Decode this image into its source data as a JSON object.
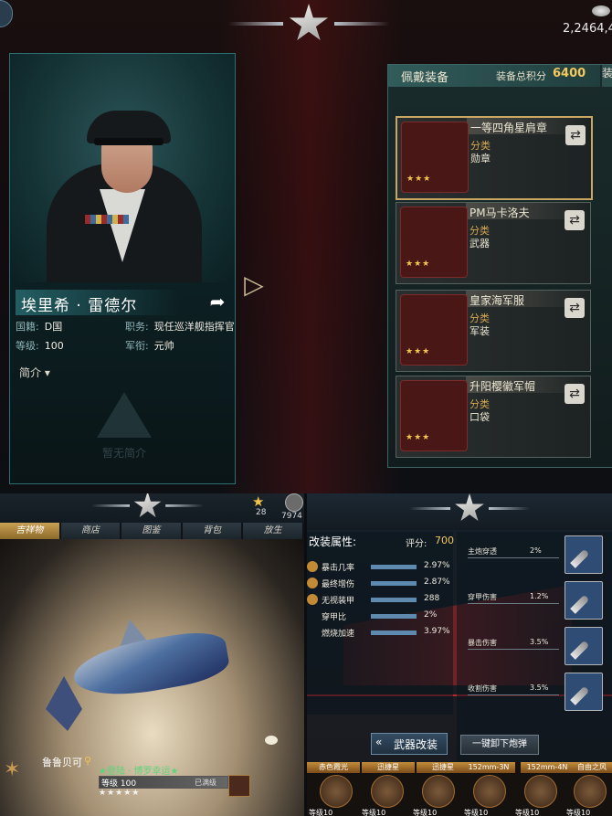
{
  "top": {
    "currency": {
      "amount": "2,2464,4"
    },
    "commander": {
      "name": "埃里希 · 雷德尔",
      "fields": [
        {
          "key": "国籍:",
          "value": "D国",
          "extra": "职务:",
          "extra_value": "现任巡洋舰指挥官"
        },
        {
          "key": "等级:",
          "value": "100",
          "extra": "军衔:",
          "extra_value": "元帅"
        }
      ],
      "intro_label": "简介",
      "no_intro": "暂无简介"
    },
    "equipment": {
      "title": "佩戴装备",
      "score_label": "装备总积分",
      "score": "6400",
      "side_tab": "装",
      "category_label": "分类",
      "items": [
        {
          "name": "一等四角星肩章",
          "category": "勋章",
          "stars": "★★★",
          "selected": true
        },
        {
          "name": "PM马卡洛夫",
          "category": "武器",
          "stars": "★★★",
          "selected": false
        },
        {
          "name": "皇家海军服",
          "category": "军装",
          "stars": "★★★",
          "selected": false
        },
        {
          "name": "升阳樱徽军帽",
          "category": "口袋",
          "stars": "★★★",
          "selected": false
        }
      ]
    }
  },
  "bottom_left": {
    "star_count": "28",
    "resource_count": "7974",
    "tabs": [
      "吉祥物",
      "商店",
      "图鉴",
      "背包",
      "放生"
    ],
    "active_tab": 0,
    "pet": {
      "name": "鲁鲁贝可",
      "title": "★登陆 · 博罗幸运★",
      "level": "等级 100",
      "max": "已满级",
      "stars": "★★★★★"
    }
  },
  "bottom_right": {
    "title": "改装属性:",
    "score_label": "评分:",
    "score": "700",
    "mod_stats": [
      {
        "label": "暴击几率",
        "value": "2.97%"
      },
      {
        "label": "最终增伤",
        "value": "2.87%"
      },
      {
        "label": "无视装甲",
        "value": "288"
      },
      {
        "label": "穿甲比",
        "value": "2%"
      },
      {
        "label": "燃烧加速",
        "value": "3.97%"
      }
    ],
    "side_stats": [
      {
        "label": "主炮穿透",
        "value": "2%"
      },
      {
        "label": "穿甲伤害",
        "value": "1.2%"
      },
      {
        "label": "暴击伤害",
        "value": "3.5%"
      },
      {
        "label": "收割伤害",
        "value": "3.5%"
      }
    ],
    "mod_button": "武器改装",
    "unload_button": "一键卸下炮弹",
    "weapons": [
      {
        "name": "赤色霞光",
        "level": "等级10"
      },
      {
        "name": "迅捷星",
        "level": "等级10"
      },
      {
        "name": "迅捷星",
        "level": "等级10"
      },
      {
        "name": "152mm-3N",
        "level": "等级10"
      },
      {
        "name": "152mm-4N",
        "level": "等级10"
      },
      {
        "name": "自由之风",
        "level": "等级10"
      }
    ]
  },
  "colors": {
    "accent_gold": "#f3c85d",
    "teal": "#2b6f73",
    "pet_title": "#5fd37b"
  }
}
